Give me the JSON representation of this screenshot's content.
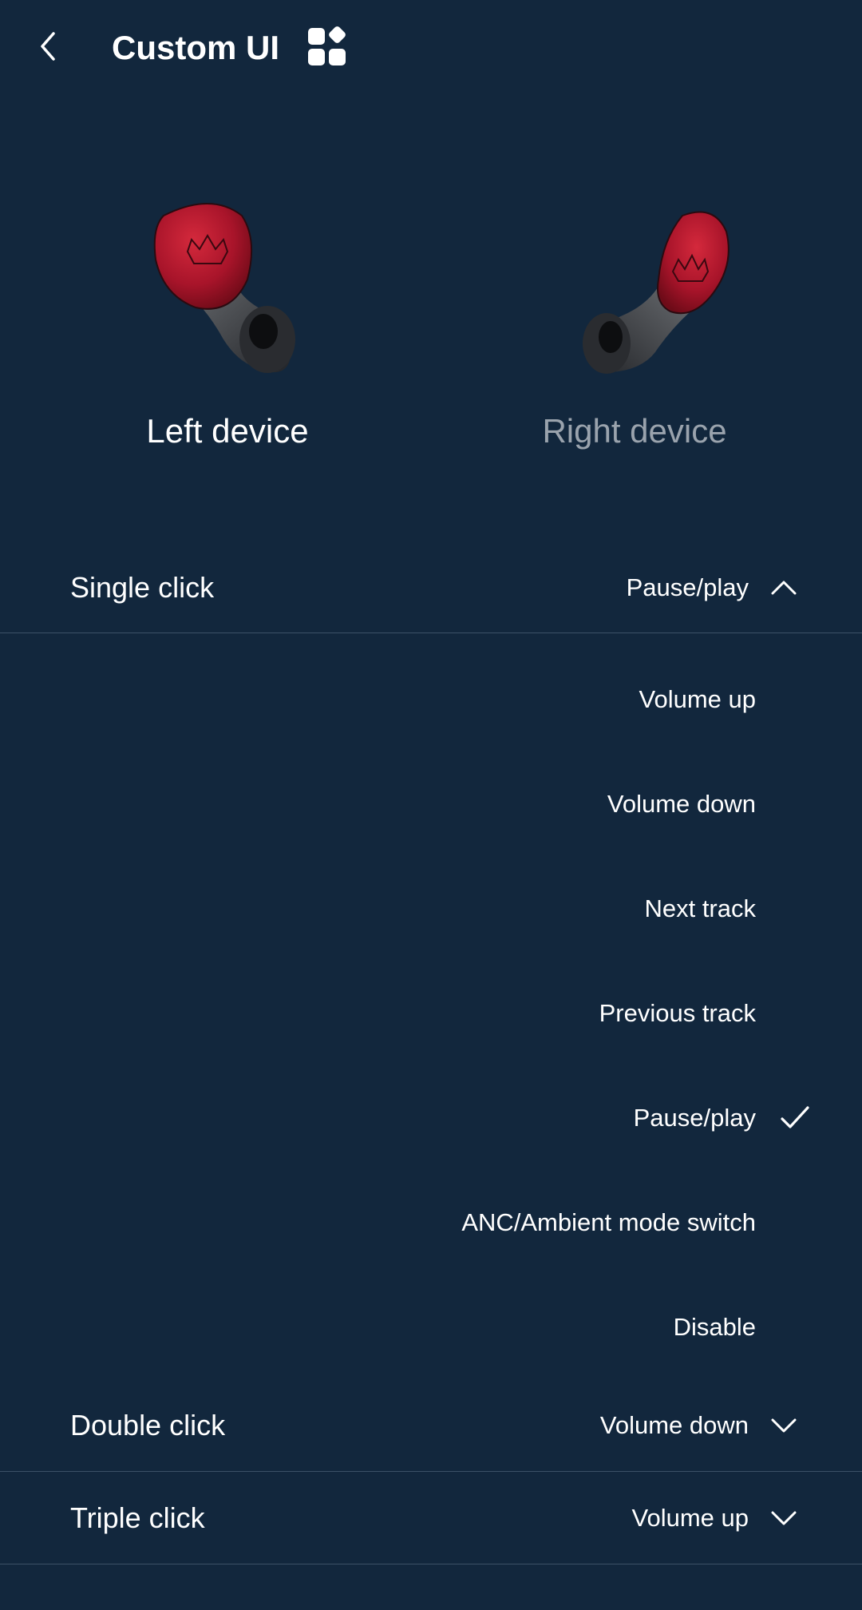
{
  "header": {
    "title": "Custom UI",
    "back_icon": "chevron-left-icon",
    "grid_icon": "widgets-icon"
  },
  "devices": {
    "left_label": "Left device",
    "right_label": "Right device",
    "selected": "left"
  },
  "colors": {
    "background": "#12273d",
    "divider": "#3c5166",
    "text_primary": "#ffffff",
    "text_inactive": "#9aa3ad",
    "earbud_shell": "#b3182b"
  },
  "settings": {
    "single_click": {
      "label": "Single click",
      "value": "Pause/play",
      "expanded": true,
      "options": [
        "Volume up",
        "Volume down",
        "Next track",
        "Previous track",
        "Pause/play",
        "ANC/Ambient mode switch",
        "Disable"
      ],
      "selected_option": "Pause/play"
    },
    "double_click": {
      "label": "Double click",
      "value": "Volume down",
      "expanded": false
    },
    "triple_click": {
      "label": "Triple click",
      "value": "Volume up",
      "expanded": false
    }
  }
}
